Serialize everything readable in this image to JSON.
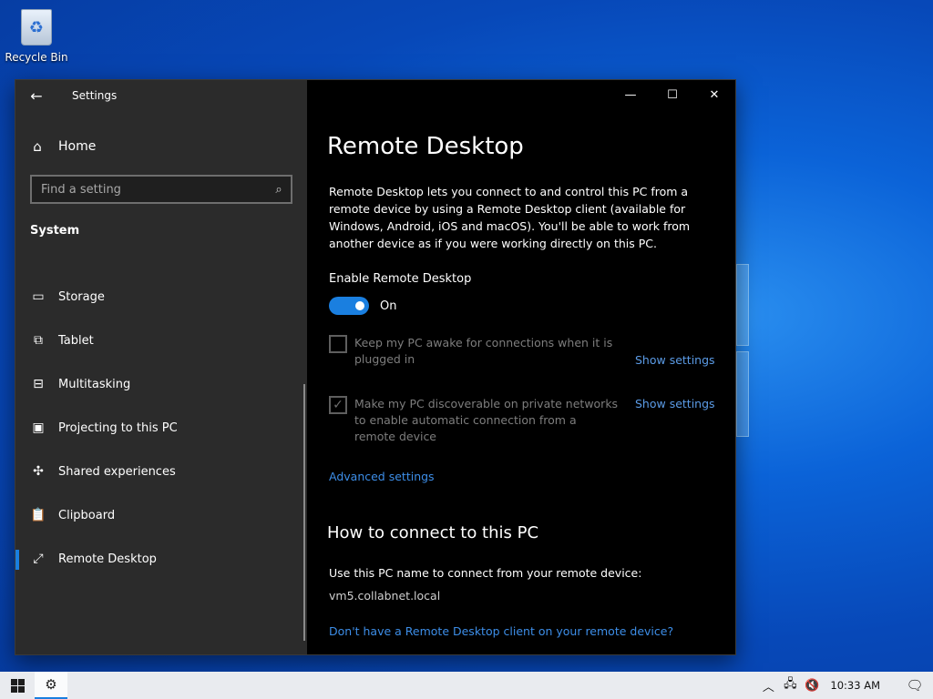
{
  "desktop": {
    "recycle_bin_label": "Recycle Bin",
    "recycle_bin_icon": "recycle-icon"
  },
  "window": {
    "app_title": "Settings",
    "back_icon": "←",
    "controls": {
      "minimize": "—",
      "maximize": "☐",
      "close": "✕"
    }
  },
  "sidebar": {
    "home_icon": "⌂",
    "home_label": "Home",
    "search_placeholder": "Find a setting",
    "search_icon": "⌕",
    "section_label": "System",
    "items": [
      {
        "icon": "▭",
        "label": "Storage",
        "icon_name": "storage-icon"
      },
      {
        "icon": "⧉",
        "label": "Tablet",
        "icon_name": "tablet-icon"
      },
      {
        "icon": "⊟",
        "label": "Multitasking",
        "icon_name": "multitasking-icon"
      },
      {
        "icon": "▣",
        "label": "Projecting to this PC",
        "icon_name": "projecting-icon"
      },
      {
        "icon": "✣",
        "label": "Shared experiences",
        "icon_name": "shared-experiences-icon"
      },
      {
        "icon": "📋",
        "label": "Clipboard",
        "icon_name": "clipboard-icon"
      },
      {
        "icon": "⤢",
        "label": "Remote Desktop",
        "icon_name": "remote-desktop-icon"
      }
    ],
    "active_item": "Remote Desktop"
  },
  "main": {
    "title": "Remote Desktop",
    "description": "Remote Desktop lets you connect to and control this PC from a remote device by using a Remote Desktop client (available for Windows, Android, iOS and macOS). You'll be able to work from another device as if you were working directly on this PC.",
    "enable_label": "Enable Remote Desktop",
    "toggle_state": "On",
    "keep_awake": {
      "label": "Keep my PC awake for connections when it is plugged in",
      "checked": false,
      "link": "Show settings"
    },
    "discoverable": {
      "label": "Make my PC discoverable on private networks to enable automatic connection from a remote device",
      "checked": true,
      "check_glyph": "✓",
      "link": "Show settings"
    },
    "advanced_link": "Advanced settings",
    "how_to_title": "How to connect to this PC",
    "use_name_text": "Use this PC name to connect from your remote device:",
    "pc_name": "vm5.collabnet.local",
    "client_link": "Don't have a Remote Desktop client on your remote device?"
  },
  "taskbar": {
    "settings_icon": "⚙",
    "tray": {
      "chevron": "︿",
      "network_icon": "🖧",
      "volume_icon": "🔇",
      "clock": "10:33 AM",
      "notification_icon": "🗨"
    }
  },
  "colors": {
    "accent": "#1a7fe0",
    "link": "#3d8ee8",
    "sidebar_bg": "#2b2b2b",
    "content_bg": "#000000"
  }
}
